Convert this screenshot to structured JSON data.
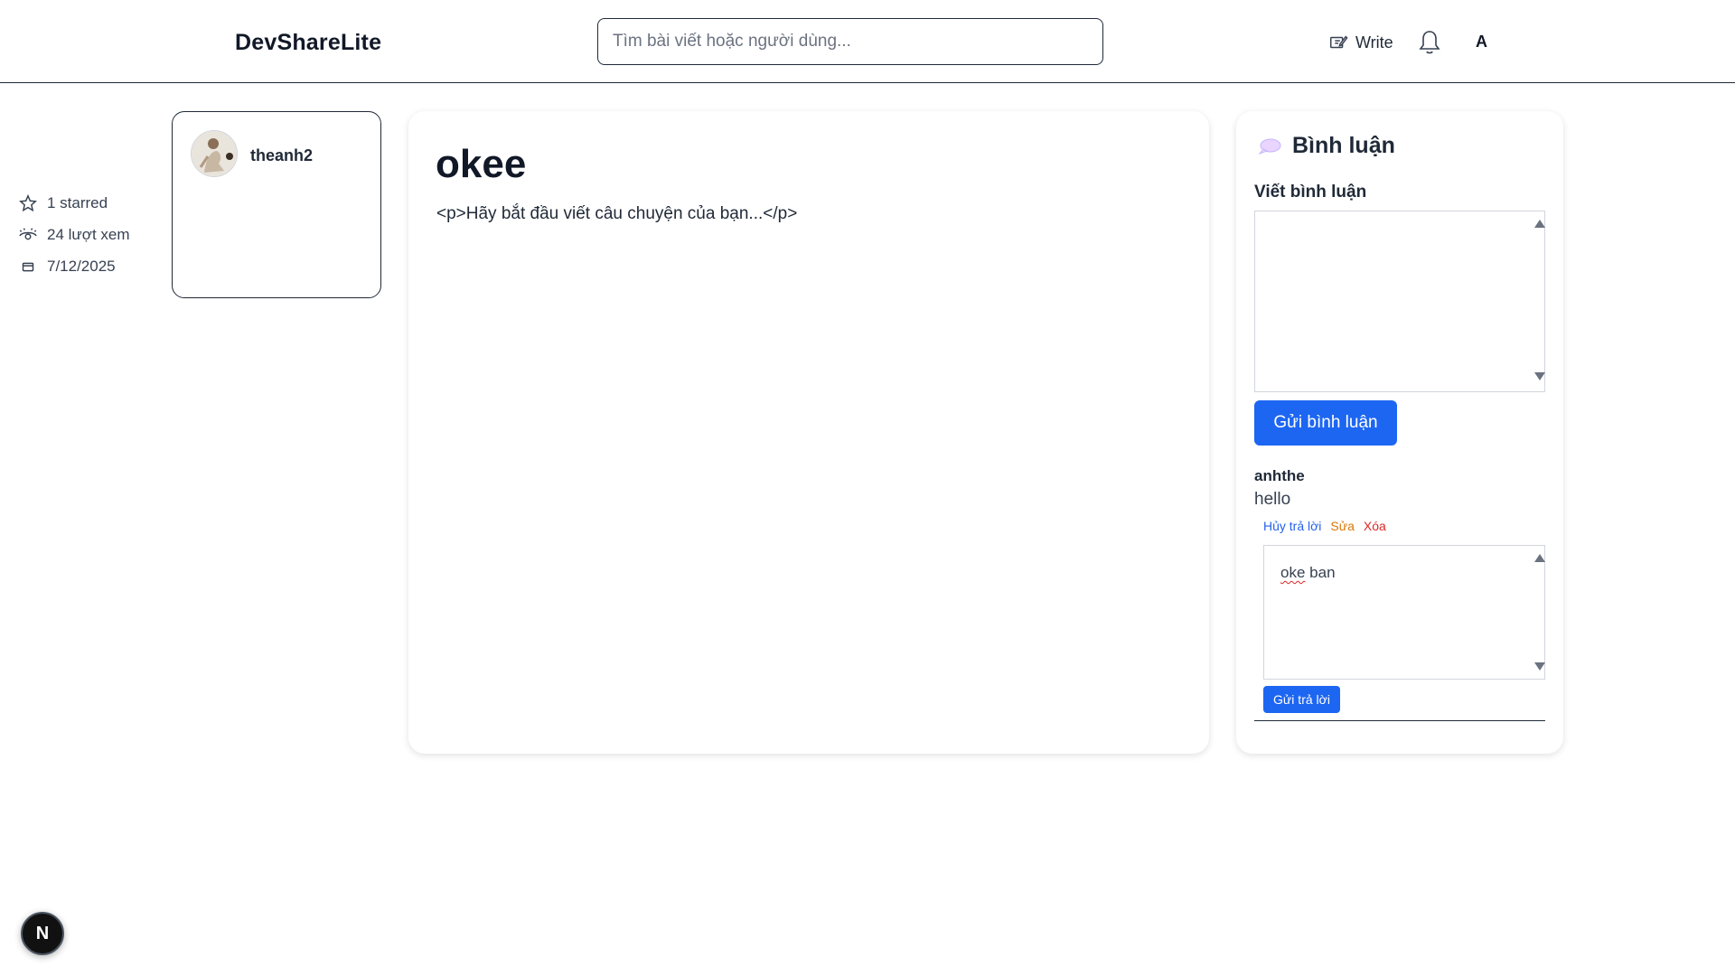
{
  "header": {
    "brand": "DevShareLite",
    "search_placeholder": "Tìm bài viết hoặc người dùng...",
    "write_label": "Write",
    "user_initial": "A"
  },
  "author": {
    "username": "theanh2",
    "stars": "1 starred",
    "views": "24 lượt xem",
    "date": "7/12/2025"
  },
  "article": {
    "title": "okee",
    "body": "<p>Hãy bắt đầu viết câu chuyện của bạn...</p>"
  },
  "comments": {
    "title": "Bình luận",
    "write_label": "Viết bình luận",
    "submit_label": "Gửi bình luận",
    "items": [
      {
        "author": "anhthe",
        "text": "hello",
        "actions": {
          "cancel_reply": "Hủy trả lời",
          "edit": "Sửa",
          "delete": "Xóa"
        },
        "reply_draft_word1": "oke",
        "reply_draft_word2": "ban",
        "reply_submit": "Gửi trả lời"
      }
    ]
  },
  "floating_badge": "N",
  "colors": {
    "primary": "#1d66f2",
    "edit": "#d97706",
    "delete": "#dc2626",
    "link": "#2563eb"
  }
}
